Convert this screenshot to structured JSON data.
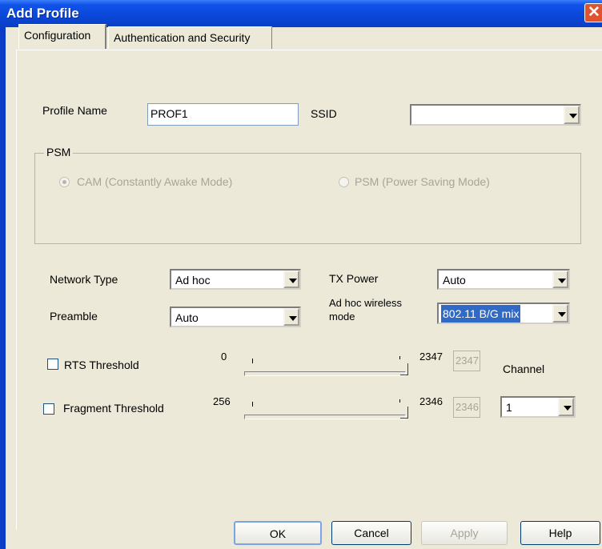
{
  "window": {
    "title": "Add Profile"
  },
  "tabs": [
    "Configuration",
    "Authentication and Security"
  ],
  "profile": {
    "name_label": "Profile Name",
    "name_value": "PROF1",
    "ssid_label": "SSID",
    "ssid_value": ""
  },
  "psm": {
    "group_label": "PSM",
    "option_cam": "CAM (Constantly Awake Mode)",
    "option_psm": "PSM (Power Saving Mode)",
    "selected": "CAM"
  },
  "network_type": {
    "label": "Network Type",
    "value": "Ad hoc"
  },
  "tx_power": {
    "label": "TX Power",
    "value": "Auto"
  },
  "preamble": {
    "label": "Preamble",
    "value": "Auto"
  },
  "adhoc_mode": {
    "label_line1": "Ad hoc wireless",
    "label_line2": "mode",
    "value": "802.11 B/G mix"
  },
  "rts": {
    "label": "RTS Threshold",
    "checked": false,
    "min": "0",
    "max": "2347",
    "value": "2347"
  },
  "fragment": {
    "label": "Fragment Threshold",
    "checked": false,
    "min": "256",
    "max": "2346",
    "value": "2346"
  },
  "channel": {
    "label": "Channel",
    "value": "1"
  },
  "buttons": {
    "ok": "OK",
    "cancel": "Cancel",
    "apply": "Apply",
    "help": "Help"
  }
}
